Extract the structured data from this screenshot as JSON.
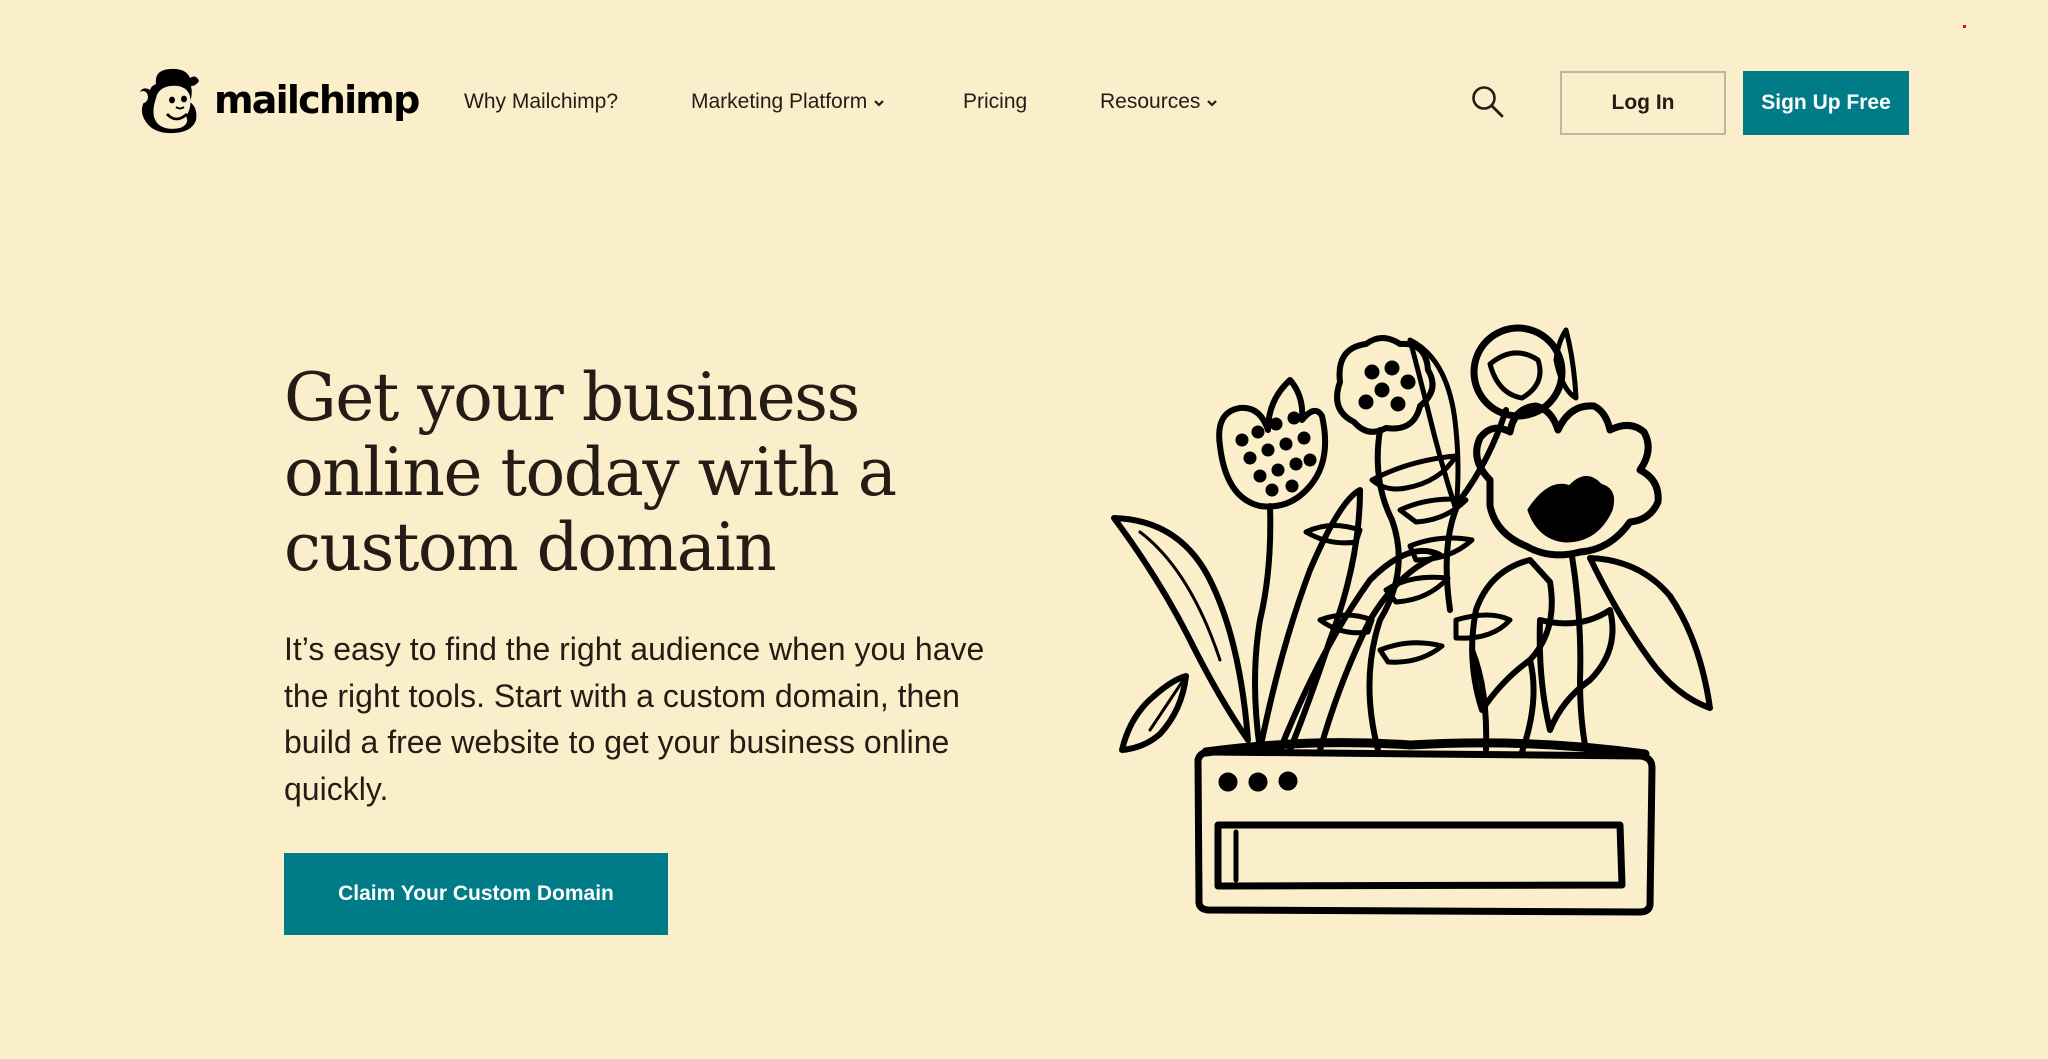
{
  "brand": {
    "name": "mailchimp",
    "accent": "#007c89",
    "background": "#fbeecb"
  },
  "nav": {
    "items": [
      {
        "label": "Why Mailchimp?",
        "has_dropdown": false
      },
      {
        "label": "Marketing Platform",
        "has_dropdown": true
      },
      {
        "label": "Pricing",
        "has_dropdown": false
      },
      {
        "label": "Resources",
        "has_dropdown": true
      }
    ],
    "search_icon": "search-icon",
    "login_label": "Log In",
    "signup_label": "Sign Up Free"
  },
  "hero": {
    "title": "Get your business online today with a custom domain",
    "body": "It’s easy to find the right audience when you have the right tools. Start with a custom domain, then build a free website to get your business online quickly.",
    "cta_label": "Claim Your Custom Domain",
    "illustration": "flowers-in-browser-window-planter"
  }
}
